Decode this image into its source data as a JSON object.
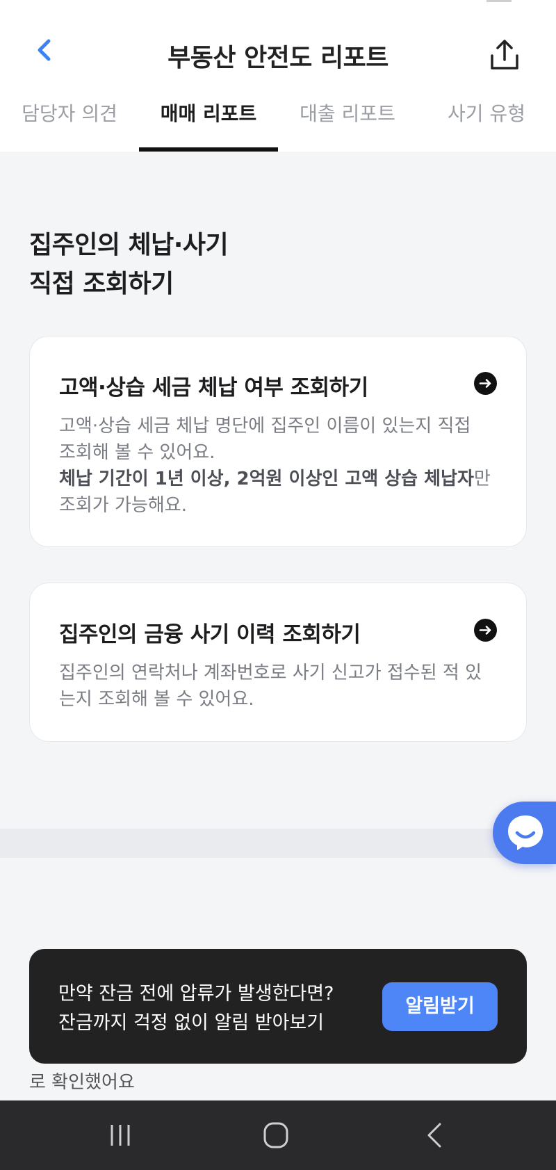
{
  "header": {
    "title": "부동산 안전도 리포트",
    "back_icon": "chevron-left-icon",
    "share_icon": "share-upload-icon"
  },
  "tabs": [
    {
      "label": "담당자 의견",
      "active": false
    },
    {
      "label": "매매 리포트",
      "active": true
    },
    {
      "label": "대출 리포트",
      "active": false
    },
    {
      "label": "사기 유형",
      "active": false
    }
  ],
  "section": {
    "title_line1": "집주인의 체납·사기",
    "title_line2": "직접 조회하기"
  },
  "cards": [
    {
      "title": "고액·상습 세금 체납 여부 조회하기",
      "desc_line1": "고액·상습 세금 체납 명단에 집주인 이름이 있는지 직접",
      "desc_line2": "조회해 볼 수 있어요.",
      "desc_bold": "체납 기간이 1년 이상, 2억원 이상인 고액 상습 체납자",
      "desc_bold_suffix": "만",
      "desc_line4": "조회가 가능해요."
    },
    {
      "title": "집주인의 금융 사기 이력 조회하기",
      "desc_line1": "집주인의 연락처나 계좌번호로 사기 신고가 접수된 적 있",
      "desc_line2": "는지 조회해 볼 수 있어요."
    }
  ],
  "banner": {
    "line1": "만약 잔금 전에 압류가 발생한다면?",
    "line2": "잔금까지 걱정 없이 알림 받아보기",
    "button_label": "알림받기"
  },
  "peek_text": "로 확인했어요",
  "colors": {
    "accent_blue": "#4f86f7",
    "back_blue": "#3b82f6",
    "banner_bg": "#222222",
    "page_bg": "#f4f5f7"
  },
  "chat_fab_icon": "chat-bubble-icon",
  "system_nav": {
    "recent_icon": "recent-apps-icon",
    "home_icon": "home-icon",
    "back_icon": "back-icon"
  }
}
